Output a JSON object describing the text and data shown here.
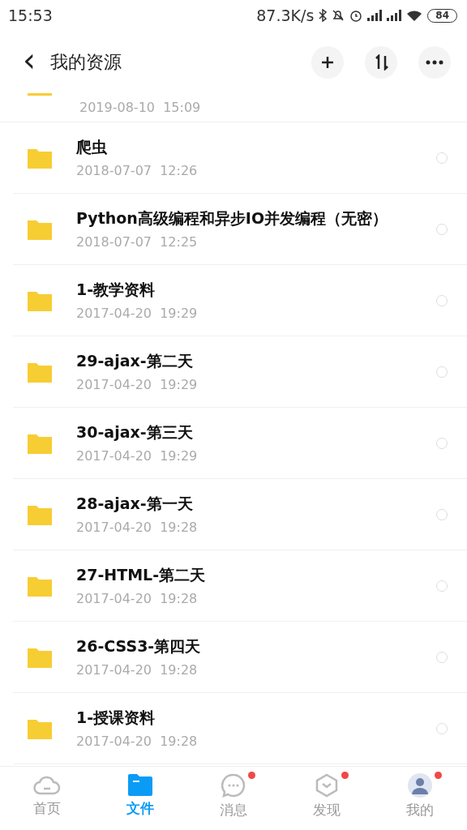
{
  "status_bar": {
    "time": "15:53",
    "speed": "87.3K/s",
    "battery": "84"
  },
  "header": {
    "back": "‹",
    "title": "我的资源"
  },
  "partial_item": {
    "date": "2019-08-10  15:09"
  },
  "items": [
    {
      "name": "爬虫",
      "date": "2018-07-07  12:26",
      "selected": false
    },
    {
      "name": "Python高级编程和异步IO并发编程（无密）",
      "date": "2018-07-07  12:25",
      "selected": false
    },
    {
      "name": "1-教学资料",
      "date": "2017-04-20  19:29",
      "selected": false
    },
    {
      "name": "29-ajax-第二天",
      "date": "2017-04-20  19:29",
      "selected": false
    },
    {
      "name": "30-ajax-第三天",
      "date": "2017-04-20  19:29",
      "selected": false
    },
    {
      "name": "28-ajax-第一天",
      "date": "2017-04-20  19:28",
      "selected": false
    },
    {
      "name": "27-HTML-第二天",
      "date": "2017-04-20  19:28",
      "selected": false
    },
    {
      "name": "26-CSS3-第四天",
      "date": "2017-04-20  19:28",
      "selected": false
    },
    {
      "name": "1-授课资料",
      "date": "2017-04-20  19:28",
      "selected": false
    }
  ],
  "tabs": [
    {
      "kind": "cloud",
      "label": "首页",
      "selected": false,
      "badge": false
    },
    {
      "kind": "folder",
      "label": "文件",
      "selected": true,
      "badge": false
    },
    {
      "kind": "chat",
      "label": "消息",
      "selected": false,
      "badge": true
    },
    {
      "kind": "cube",
      "label": "发现",
      "selected": false,
      "badge": true
    },
    {
      "kind": "avatar",
      "label": "我的",
      "selected": false,
      "badge": true
    }
  ]
}
